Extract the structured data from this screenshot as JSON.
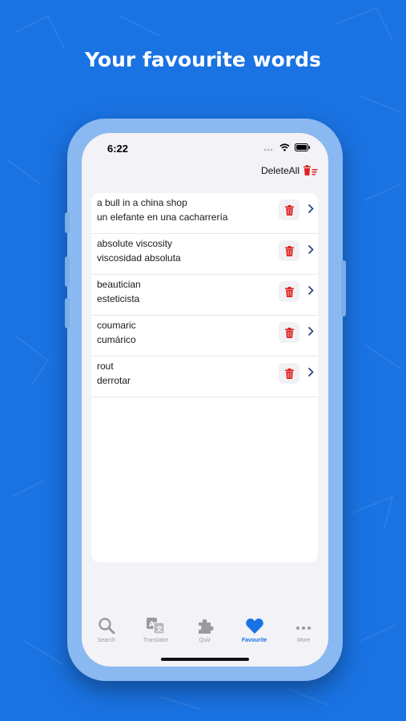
{
  "headline": "Your favourite words",
  "status_bar": {
    "time": "6:22"
  },
  "toolbar": {
    "delete_all_label": "DeleteAll"
  },
  "favourites": [
    {
      "term": "a bull in a china shop",
      "translation": "un elefante en una cacharrería"
    },
    {
      "term": "absolute viscosity",
      "translation": "viscosidad absoluta"
    },
    {
      "term": "beautician",
      "translation": "esteticista"
    },
    {
      "term": "coumaric",
      "translation": "cumárico"
    },
    {
      "term": "rout",
      "translation": "derrotar"
    }
  ],
  "tabs": [
    {
      "label": "Search",
      "icon": "search-icon",
      "active": false
    },
    {
      "label": "Translator",
      "icon": "translator-icon",
      "active": false
    },
    {
      "label": "Quiz",
      "icon": "puzzle-icon",
      "active": false
    },
    {
      "label": "Favourite",
      "icon": "heart-icon",
      "active": true
    },
    {
      "label": "More",
      "icon": "more-icon",
      "active": false
    }
  ],
  "colors": {
    "background": "#1a73e3",
    "accent": "#1a73e3",
    "delete_red": "#e02020",
    "phone_frame": "#8ab8f0"
  }
}
